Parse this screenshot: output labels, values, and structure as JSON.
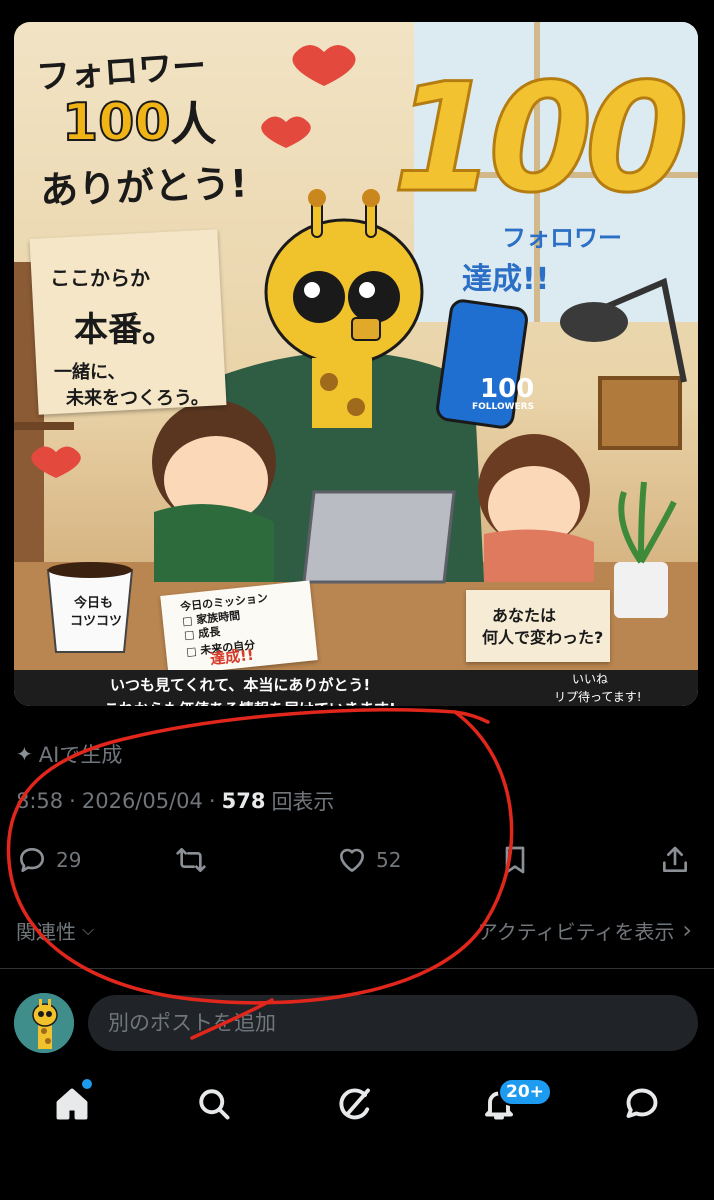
{
  "post_image": {
    "title_line1": "フォロワー",
    "title_line2_num": "100",
    "title_line2_unit": "人",
    "title_line3": "ありがとう!",
    "big_number": "100",
    "milestone_line1": "フォロワー",
    "milestone_line2": "達成!!",
    "note_line1": "ここからか",
    "note_line2": "本番。",
    "note_line3": "一緒に、",
    "note_line4": "未来をつくろう。",
    "cup_line1": "今日も",
    "cup_line2": "コツコツ",
    "mission_title": "今日のミッション",
    "mission_item1": "□ 家族時間",
    "mission_item2": "□ 成長",
    "mission_item3": "□ 未来の自分",
    "mission_done": "達成!!",
    "question_line1": "あなたは",
    "question_line2": "何人で変わった?",
    "phone_number": "100",
    "phone_label": "FOLLOWERS",
    "banner_line1": "いつも見てくれて、本当にありがとう!",
    "banner_line2": "これからも価値ある情報を届けていきます!",
    "bubble_line1": "いいね",
    "bubble_line2": "リプ待ってます!"
  },
  "ai_label": "AIで生成",
  "meta": {
    "time": "8:58",
    "date": "2026/05/04",
    "views_count": "578",
    "views_label": "回表示"
  },
  "actions": {
    "reply_count": "29",
    "like_count": "52"
  },
  "relevance_label": "関連性",
  "activity_label": "アクティビティを表示",
  "composer": {
    "placeholder": "別のポストを追加"
  },
  "nav": {
    "notification_badge": "20+"
  },
  "colors": {
    "accent": "#1d9bf0",
    "muted": "#71767b",
    "annotation": "#e1261c"
  }
}
